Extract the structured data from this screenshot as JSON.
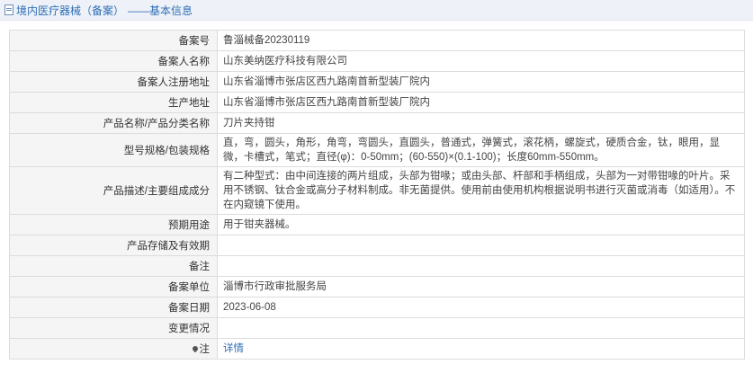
{
  "header": {
    "title": "境内医疗器械（备案）",
    "subtitle": "——基本信息"
  },
  "rows": [
    {
      "label": "备案号",
      "value": "鲁淄械备20230119"
    },
    {
      "label": "备案人名称",
      "value": "山东美纳医疗科技有限公司"
    },
    {
      "label": "备案人注册地址",
      "value": "山东省淄博市张店区西九路南首新型装厂院内"
    },
    {
      "label": "生产地址",
      "value": "山东省淄博市张店区西九路南首新型装厂院内"
    },
    {
      "label": "产品名称/产品分类名称",
      "value": "刀片夹持钳"
    },
    {
      "label": "型号规格/包装规格",
      "value": "直，弯，圆头，角形，角弯，弯圆头，直圆头，普通式，弹簧式，滚花柄，螺旋式，硬质合金，钛，眼用，显微，卡槽式，笔式；直径(φ)：0-50mm；(60-550)×(0.1-100)；长度60mm-550mm。"
    },
    {
      "label": "产品描述/主要组成成分",
      "value": "有二种型式：由中间连接的两片组成，头部为钳喙；或由头部、杆部和手柄组成，头部为一对带钳喙的叶片。采用不锈钢、钛合金或高分子材料制成。非无菌提供。使用前由使用机构根据说明书进行灭菌或消毒（如适用）。不在内窥镜下使用。"
    },
    {
      "label": "预期用途",
      "value": "用于钳夹器械。"
    },
    {
      "label": "产品存储及有效期",
      "value": ""
    },
    {
      "label": "备注",
      "value": ""
    },
    {
      "label": "备案单位",
      "value": "淄博市行政审批服务局"
    },
    {
      "label": "备案日期",
      "value": "2023-06-08"
    },
    {
      "label": "变更情况",
      "value": ""
    },
    {
      "label": "注",
      "value": "详情"
    }
  ]
}
